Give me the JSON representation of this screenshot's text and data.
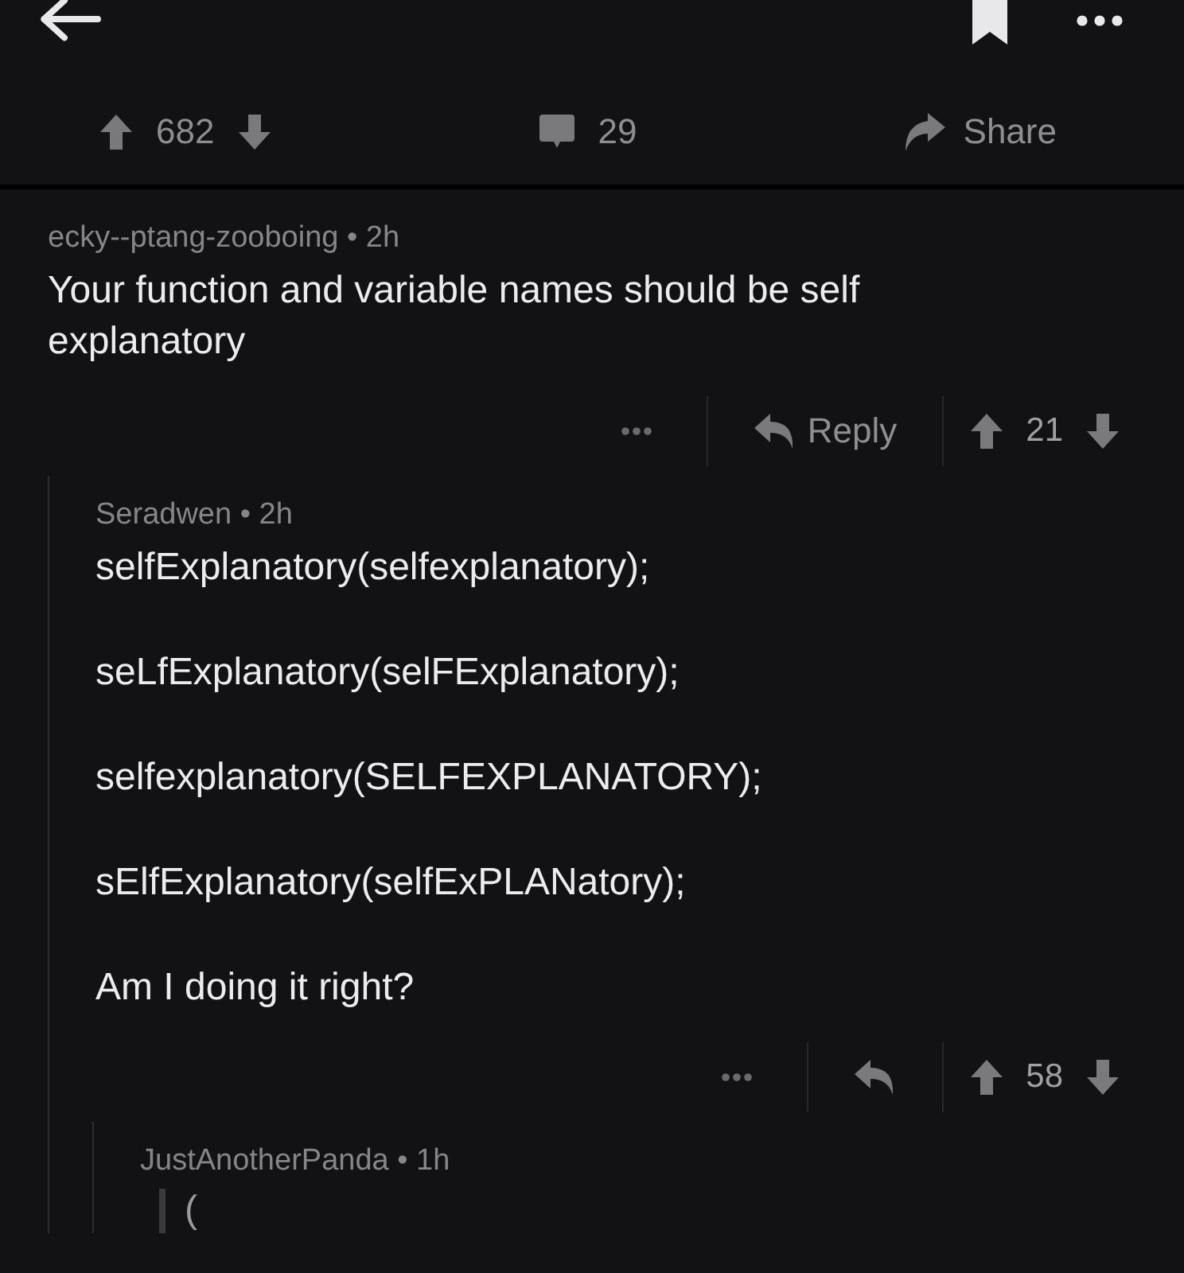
{
  "post_actions": {
    "score": "682",
    "comments": "29",
    "share": "Share"
  },
  "comments": [
    {
      "meta": "ecky--ptang-zooboing • 2h",
      "body": [
        {
          "kind": "text",
          "text": "Your function and variable names should be self explanatory"
        }
      ],
      "reply_label": "Reply",
      "score": "21",
      "children": [
        {
          "meta": "Seradwen • 2h",
          "body": [
            {
              "kind": "text",
              "text": "selfExplanatory(selfexplanatory);"
            },
            {
              "kind": "text",
              "text": "seLfExplanatory(selFExplanatory);"
            },
            {
              "kind": "text",
              "text": "selfexplanatory(SELFEXPLANATORY);"
            },
            {
              "kind": "text",
              "text": "sElfExplanatory(selfExPLANatory);"
            },
            {
              "kind": "text",
              "text": "Am I doing it right?"
            }
          ],
          "score": "58",
          "children": [
            {
              "meta": "JustAnotherPanda • 1h",
              "body": [
                {
                  "kind": "quote",
                  "text": "("
                }
              ]
            }
          ]
        }
      ]
    }
  ]
}
